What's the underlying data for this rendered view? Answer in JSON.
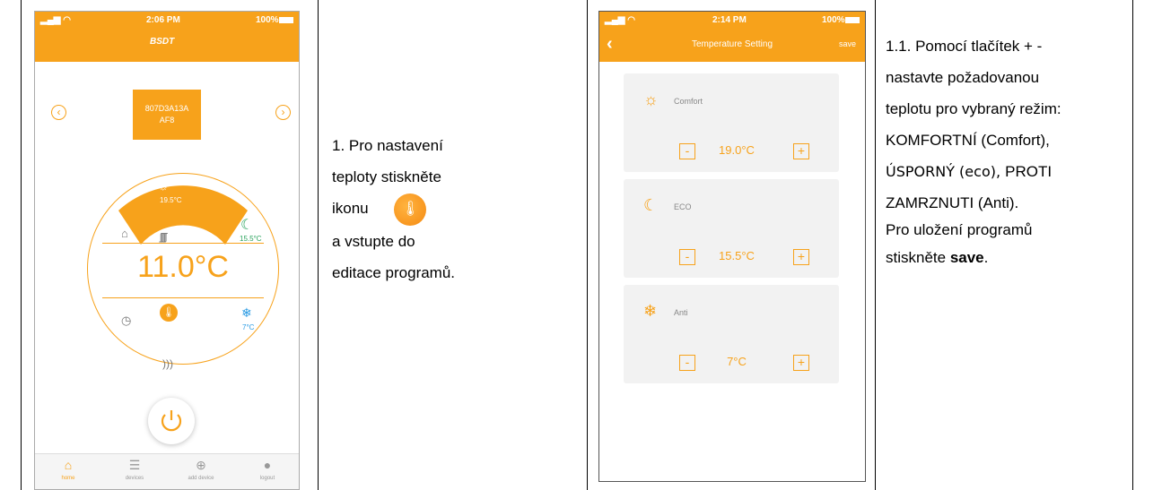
{
  "phone1": {
    "status": {
      "time": "2:06 PM",
      "battery": "100%"
    },
    "logo": "BSDT",
    "device_id_line1": "807D3A13A",
    "device_id_line2": "AF8",
    "comfort_temp": "19.5°C",
    "eco_temp": "15.5°C",
    "anti_temp": "7°C",
    "current_temp": "11.0°C",
    "tabs": [
      {
        "label": "home",
        "icon": "home-icon",
        "active": true
      },
      {
        "label": "devices",
        "icon": "list-icon",
        "active": false
      },
      {
        "label": "add device",
        "icon": "plus-circle-icon",
        "active": false
      },
      {
        "label": "logout",
        "icon": "user-icon",
        "active": false
      }
    ]
  },
  "instruction1": {
    "line1": "1. Pro nastavení",
    "line2": "teploty stiskněte",
    "line3": "ikonu",
    "line4": "a vstupte do",
    "line5": "editace programů."
  },
  "phone2": {
    "status": {
      "time": "2:14 PM",
      "battery": "100%"
    },
    "title": "Temperature Setting",
    "save_label": "save",
    "modes": [
      {
        "name": "Comfort",
        "value": "19.0°C",
        "icon": "sun-icon"
      },
      {
        "name": "ECO",
        "value": "15.5°C",
        "icon": "moon-icon"
      },
      {
        "name": "Anti",
        "value": "7°C",
        "icon": "snowflake-icon"
      }
    ],
    "minus": "-",
    "plus": "+"
  },
  "instruction2": {
    "line1": "1.1. Pomocí tlačítek + -",
    "line2": "nastavte požadovanou",
    "line3": "teplotu pro vybraný režim:",
    "line4": "KOMFORTNÍ (Comfort),",
    "line5a": "ÚSPORNÝ (eco), ",
    "line5b": "PROTI",
    "line6": "ZAMRZNUTI (Anti).",
    "line7": "Pro uložení programů",
    "line8a": "stiskněte ",
    "line8b": "save",
    "line8c": "."
  },
  "colors": {
    "accent": "#f7a21b",
    "green": "#27a25a",
    "blue": "#2a9be3"
  }
}
